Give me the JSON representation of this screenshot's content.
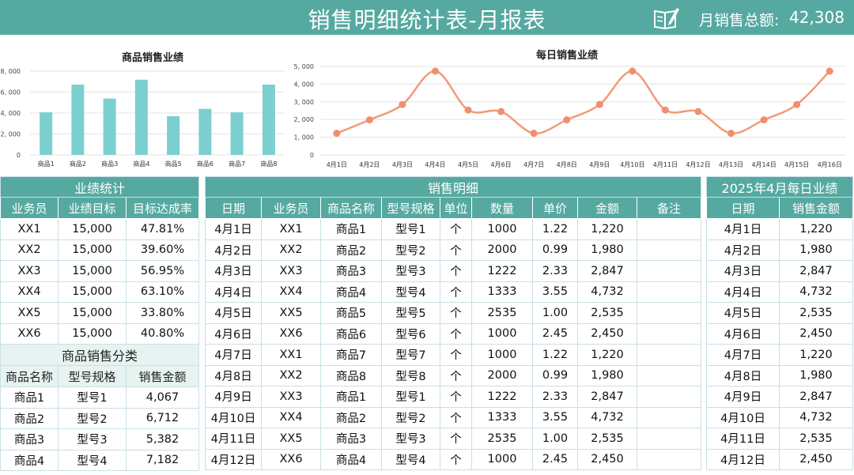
{
  "header": {
    "title": "销售明细统计表-月报表",
    "total_label": "月销售总额:",
    "total_value": "42,308",
    "icon": "document-pen-icon"
  },
  "colors": {
    "accent": "#55a9a0",
    "bar": "#7ccfcf",
    "line": "#f29a78",
    "point": "#f08f6e",
    "light": "#e6f3f1"
  },
  "chart_data": [
    {
      "type": "bar",
      "title": "商品销售业绩",
      "categories": [
        "商品1",
        "商品2",
        "商品3",
        "商品4",
        "商品5",
        "商品6",
        "商品7",
        "商品8"
      ],
      "values": [
        4067,
        6712,
        5382,
        7182,
        3700,
        4400,
        4067,
        6712
      ],
      "ylim": [
        0,
        8000
      ],
      "yticks": [
        0,
        2000,
        4000,
        6000,
        8000
      ],
      "ytick_labels": [
        "0",
        "2, 000",
        "4, 000",
        "6, 000",
        "8, 000"
      ],
      "grid": true
    },
    {
      "type": "line",
      "title": "每日销售业绩",
      "categories": [
        "4月1日",
        "4月2日",
        "4月3日",
        "4月4日",
        "4月5日",
        "4月6日",
        "4月7日",
        "4月8日",
        "4月9日",
        "4月10日",
        "4月11日",
        "4月12日",
        "4月13日",
        "4月14日",
        "4月15日",
        "4月16日"
      ],
      "values": [
        1220,
        1980,
        2847,
        4732,
        2535,
        2450,
        1220,
        1980,
        2847,
        4732,
        2535,
        2450,
        1220,
        1980,
        2847,
        4732
      ],
      "ylim": [
        0,
        5000
      ],
      "yticks": [
        0,
        1000,
        2000,
        3000,
        4000,
        5000
      ],
      "ytick_labels": [
        "0",
        "1, 000",
        "2, 000",
        "3, 000",
        "4, 000",
        "5, 000"
      ],
      "grid": true
    }
  ],
  "performance": {
    "title": "业绩统计",
    "headers": [
      "业务员",
      "业绩目标",
      "目标达成率"
    ],
    "rows": [
      [
        "XX1",
        "15,000",
        "47.81%"
      ],
      [
        "XX2",
        "15,000",
        "39.60%"
      ],
      [
        "XX3",
        "15,000",
        "56.95%"
      ],
      [
        "XX4",
        "15,000",
        "63.10%"
      ],
      [
        "XX5",
        "15,000",
        "33.80%"
      ],
      [
        "XX6",
        "15,000",
        "40.80%"
      ]
    ]
  },
  "category": {
    "title": "商品销售分类",
    "headers": [
      "商品名称",
      "型号规格",
      "销售金额"
    ],
    "rows": [
      [
        "商品1",
        "型号1",
        "4,067"
      ],
      [
        "商品2",
        "型号2",
        "6,712"
      ],
      [
        "商品3",
        "型号3",
        "5,382"
      ],
      [
        "商品4",
        "型号4",
        "7,182"
      ]
    ]
  },
  "detail": {
    "title": "销售明细",
    "headers": [
      "日期",
      "业务员",
      "商品名称",
      "型号规格",
      "单位",
      "数量",
      "单价",
      "金额",
      "备注"
    ],
    "rows": [
      [
        "4月1日",
        "XX1",
        "商品1",
        "型号1",
        "个",
        "1000",
        "1.22",
        "1,220",
        ""
      ],
      [
        "4月2日",
        "XX2",
        "商品2",
        "型号2",
        "个",
        "2000",
        "0.99",
        "1,980",
        ""
      ],
      [
        "4月3日",
        "XX3",
        "商品3",
        "型号3",
        "个",
        "1222",
        "2.33",
        "2,847",
        ""
      ],
      [
        "4月4日",
        "XX4",
        "商品4",
        "型号4",
        "个",
        "1333",
        "3.55",
        "4,732",
        ""
      ],
      [
        "4月5日",
        "XX5",
        "商品5",
        "型号5",
        "个",
        "2535",
        "1.00",
        "2,535",
        ""
      ],
      [
        "4月6日",
        "XX6",
        "商品6",
        "型号6",
        "个",
        "1000",
        "2.45",
        "2,450",
        ""
      ],
      [
        "4月7日",
        "XX1",
        "商品7",
        "型号7",
        "个",
        "1000",
        "1.22",
        "1,220",
        ""
      ],
      [
        "4月8日",
        "XX2",
        "商品8",
        "型号8",
        "个",
        "2000",
        "0.99",
        "1,980",
        ""
      ],
      [
        "4月9日",
        "XX3",
        "商品1",
        "型号1",
        "个",
        "1222",
        "2.33",
        "2,847",
        ""
      ],
      [
        "4月10日",
        "XX4",
        "商品2",
        "型号2",
        "个",
        "1333",
        "3.55",
        "4,732",
        ""
      ],
      [
        "4月11日",
        "XX5",
        "商品3",
        "型号3",
        "个",
        "2535",
        "1.00",
        "2,535",
        ""
      ],
      [
        "4月12日",
        "XX6",
        "商品4",
        "型号4",
        "个",
        "1000",
        "2.45",
        "2,450",
        ""
      ]
    ]
  },
  "daily": {
    "title": "2025年4月每日业绩",
    "headers": [
      "日期",
      "销售金额"
    ],
    "rows": [
      [
        "4月1日",
        "1,220"
      ],
      [
        "4月2日",
        "1,980"
      ],
      [
        "4月3日",
        "2,847"
      ],
      [
        "4月4日",
        "4,732"
      ],
      [
        "4月5日",
        "2,535"
      ],
      [
        "4月6日",
        "2,450"
      ],
      [
        "4月7日",
        "1,220"
      ],
      [
        "4月8日",
        "1,980"
      ],
      [
        "4月9日",
        "2,847"
      ],
      [
        "4月10日",
        "4,732"
      ],
      [
        "4月11日",
        "2,535"
      ],
      [
        "4月12日",
        "2,450"
      ]
    ]
  }
}
